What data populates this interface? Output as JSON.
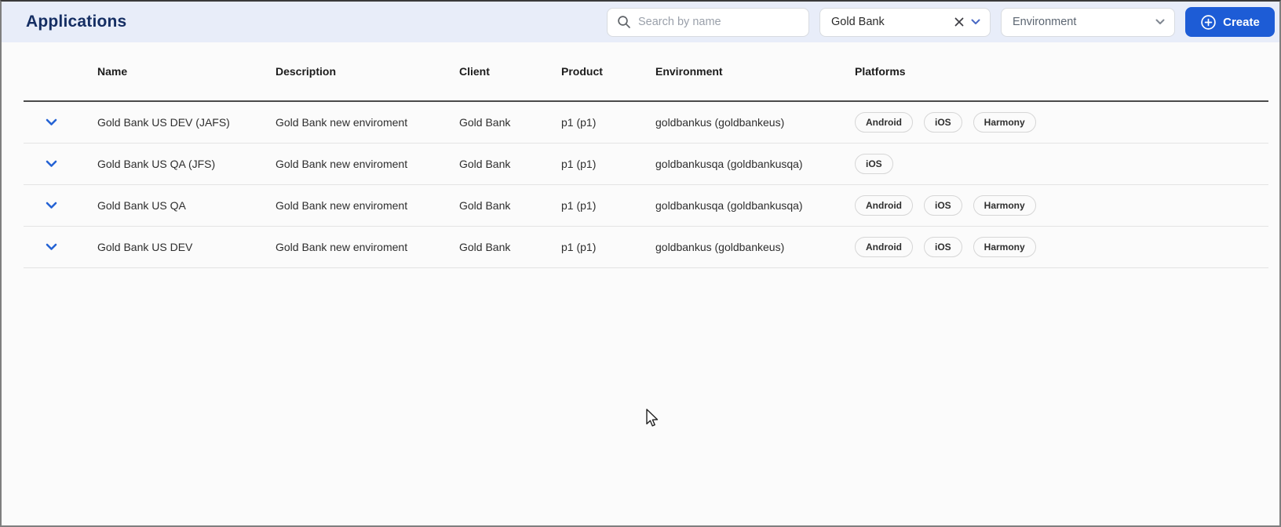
{
  "header": {
    "title": "Applications",
    "search": {
      "placeholder": "Search by name"
    },
    "client_filter": {
      "value": "Gold Bank"
    },
    "environment_filter": {
      "placeholder": "Environment"
    },
    "create_button": {
      "label": "Create"
    }
  },
  "table": {
    "columns": [
      "Name",
      "Description",
      "Client",
      "Product",
      "Environment",
      "Platforms"
    ],
    "rows": [
      {
        "name": "Gold Bank US DEV (JAFS)",
        "description": "Gold Bank new enviroment",
        "client": "Gold Bank",
        "product": "p1 (p1)",
        "environment": "goldbankus (goldbankeus)",
        "platforms": [
          "Android",
          "iOS",
          "Harmony"
        ]
      },
      {
        "name": "Gold Bank US QA (JFS)",
        "description": "Gold Bank new enviroment",
        "client": "Gold Bank",
        "product": "p1 (p1)",
        "environment": "goldbankusqa (goldbankusqa)",
        "platforms": [
          "iOS"
        ]
      },
      {
        "name": "Gold Bank US QA",
        "description": "Gold Bank new enviroment",
        "client": "Gold Bank",
        "product": "p1 (p1)",
        "environment": "goldbankusqa (goldbankusqa)",
        "platforms": [
          "Android",
          "iOS",
          "Harmony"
        ]
      },
      {
        "name": "Gold Bank US DEV",
        "description": "Gold Bank new enviroment",
        "client": "Gold Bank",
        "product": "p1 (p1)",
        "environment": "goldbankus (goldbankeus)",
        "platforms": [
          "Android",
          "iOS",
          "Harmony"
        ]
      }
    ]
  },
  "icons": {
    "search": "magnifier",
    "clear": "x-cross",
    "chevron": "chevron-down",
    "plus": "plus-in-circle",
    "cursor": "arrow-pointer"
  },
  "colors": {
    "topbar_bg": "#e8edf9",
    "title": "#152e63",
    "accent_blue": "#1d5cd6",
    "row_chevron_blue": "#2563d4",
    "header_rule": "#4a4a4a",
    "row_rule": "#e3e3e3"
  }
}
